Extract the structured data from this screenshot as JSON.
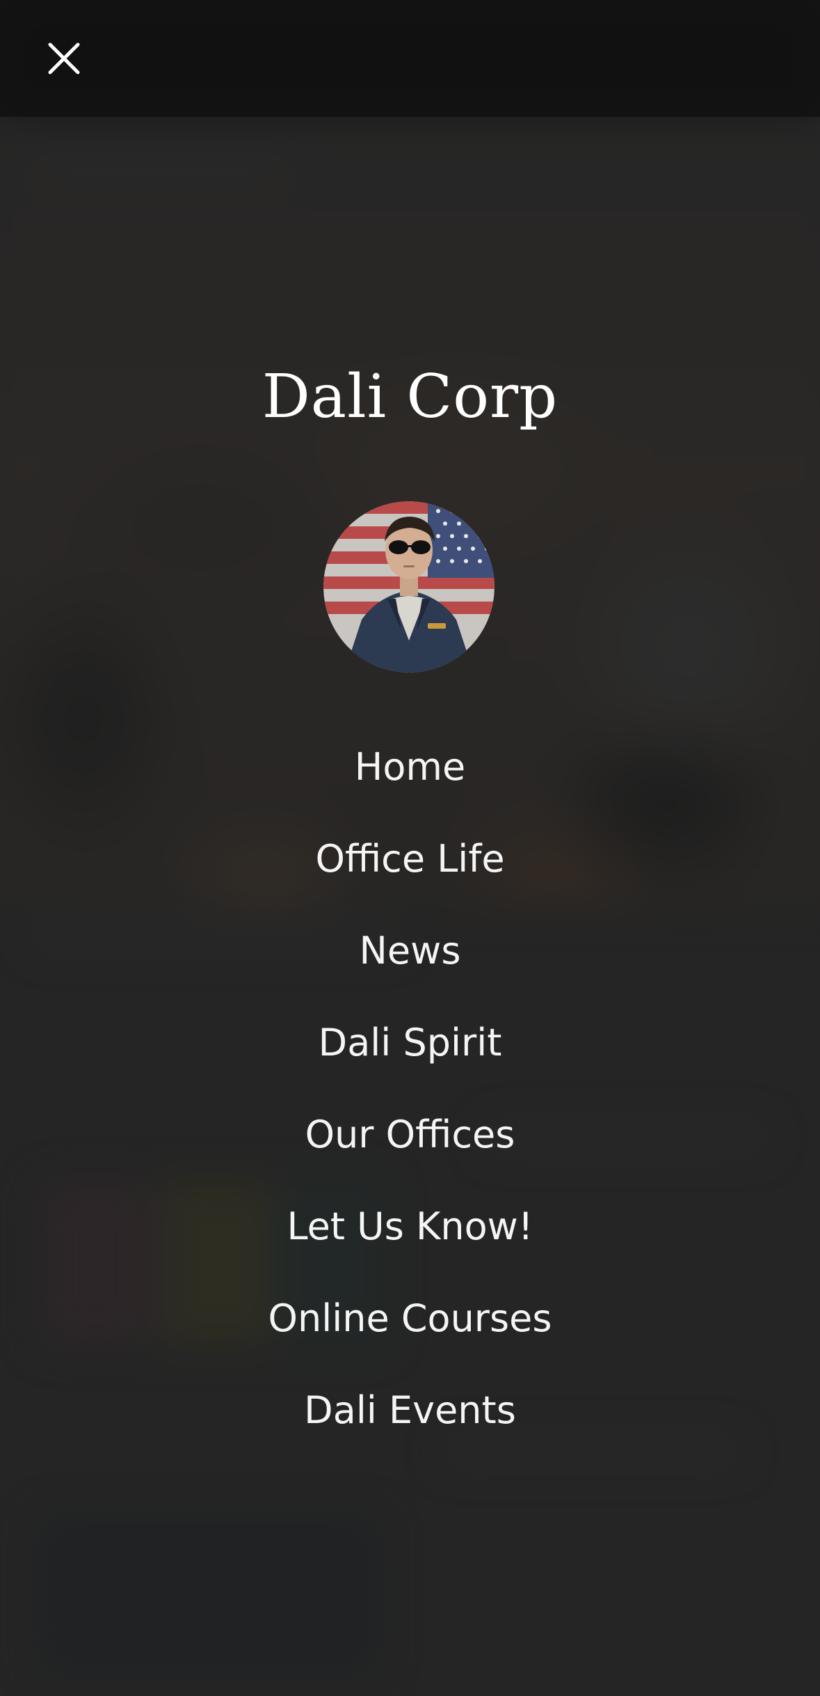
{
  "header": {
    "close_icon": "close-icon"
  },
  "brand": {
    "title": "Dali Corp"
  },
  "avatar": {
    "description_icon": "profile-avatar"
  },
  "menu": {
    "items": [
      {
        "label": "Home"
      },
      {
        "label": "Office Life"
      },
      {
        "label": "News"
      },
      {
        "label": "Dali Spirit"
      },
      {
        "label": "Our Offices"
      },
      {
        "label": "Let Us Know!"
      },
      {
        "label": "Online Courses"
      },
      {
        "label": "Dali Events"
      }
    ]
  },
  "colors": {
    "overlay_background": "#282828",
    "menu_text": "#f5f5f5",
    "title_text": "#ffffff"
  }
}
